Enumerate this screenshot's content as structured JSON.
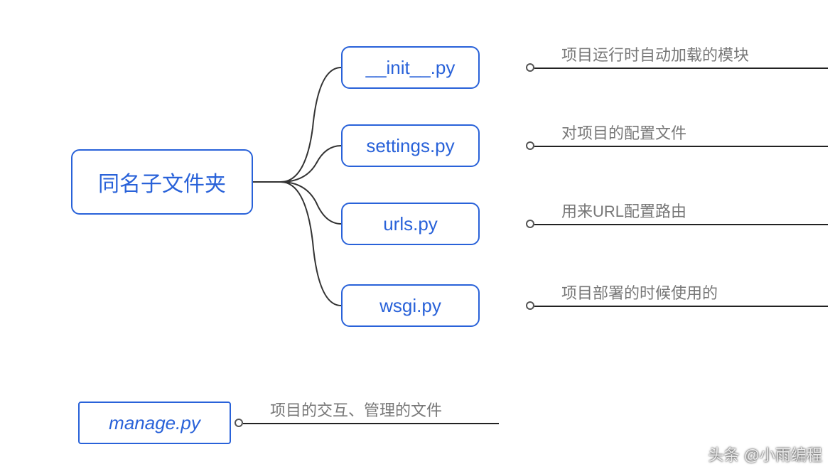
{
  "root": {
    "label": "同名子文件夹"
  },
  "children": [
    {
      "label": "__init__.py",
      "desc": "项目运行时自动加载的模块"
    },
    {
      "label": "settings.py",
      "desc": "对项目的配置文件"
    },
    {
      "label": "urls.py",
      "desc": "用来URL配置路由"
    },
    {
      "label": "wsgi.py",
      "desc": "项目部署的时候使用的"
    }
  ],
  "manage": {
    "label": "manage.py",
    "desc": "项目的交互、管理的文件"
  },
  "watermark": "头条 @小雨编程"
}
